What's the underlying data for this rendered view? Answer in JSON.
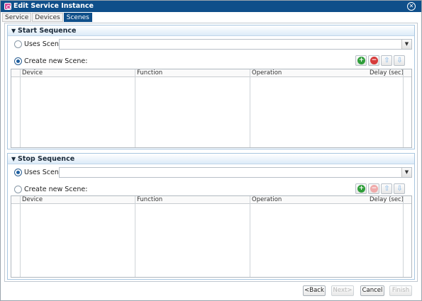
{
  "window": {
    "title": "Edit Service Instance",
    "close_glyph": "✕"
  },
  "tabs": [
    {
      "label": "Service",
      "active": false
    },
    {
      "label": "Devices",
      "active": false
    },
    {
      "label": "Scenes",
      "active": true
    }
  ],
  "start_sequence": {
    "title": "Start Sequence",
    "uses_scene_label": "Uses Scene:",
    "uses_scene_selected": false,
    "uses_scene_value": "",
    "create_new_label": "Create new Scene:",
    "create_new_selected": true,
    "columns": [
      "Device",
      "Function",
      "Operation",
      "Delay (sec)"
    ]
  },
  "stop_sequence": {
    "title": "Stop Sequence",
    "uses_scene_label": "Uses Scene:",
    "uses_scene_selected": true,
    "uses_scene_value": "",
    "create_new_label": "Create new Scene:",
    "create_new_selected": false,
    "columns": [
      "Device",
      "Function",
      "Operation",
      "Delay (sec)"
    ]
  },
  "icons": {
    "add": "+",
    "remove": "−",
    "up": "⇧",
    "down": "⇩",
    "collapse": "▼",
    "dropdown": "▼"
  },
  "footer": {
    "back_label": "<Back",
    "next_label": "Next>",
    "cancel_label": "Cancel",
    "finish_label": "Finish"
  },
  "colors": {
    "titlebar": "#0f4f8a",
    "section_border": "#a8c6e0",
    "add_green": "#2f9e3a",
    "remove_red": "#d63b3b"
  }
}
